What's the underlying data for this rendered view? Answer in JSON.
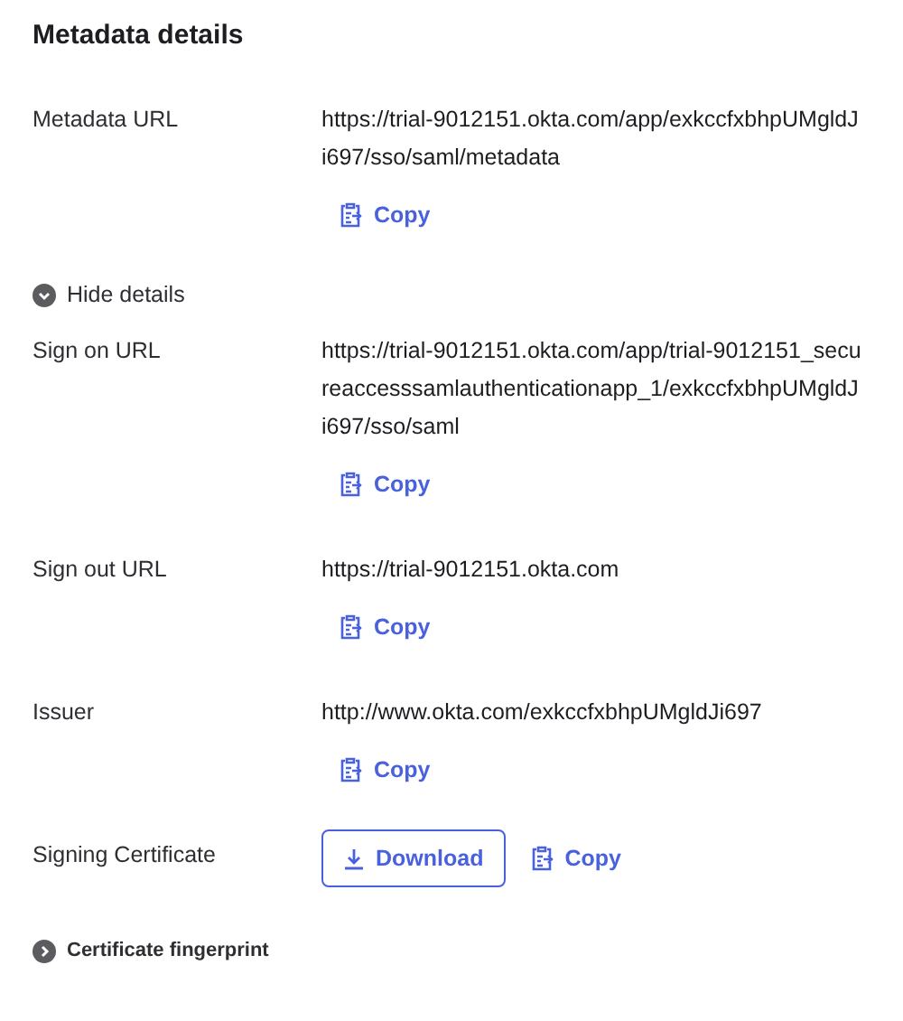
{
  "title": "Metadata details",
  "sections": [
    {
      "kind": "field",
      "label": "Metadata URL",
      "value": "https://trial-9012151.okta.com/app/exkccfxbhpUMgldJi697/sso/saml/metadata",
      "copy": "Copy"
    },
    {
      "kind": "toggle",
      "label": "Hide details",
      "expanded": true,
      "bold": false
    },
    {
      "kind": "field",
      "label": "Sign on URL",
      "value": "https://trial-9012151.okta.com/app/trial-9012151_secureaccesssamlauthenticationapp_1/exkccfxbhpUMgldJi697/sso/saml",
      "copy": "Copy"
    },
    {
      "kind": "field",
      "label": "Sign out URL",
      "value": "https://trial-9012151.okta.com",
      "copy": "Copy"
    },
    {
      "kind": "field",
      "label": "Issuer",
      "value": "http://www.okta.com/exkccfxbhpUMgldJi697",
      "copy": "Copy"
    },
    {
      "kind": "certificate",
      "label": "Signing Certificate",
      "download": "Download",
      "copy": "Copy"
    },
    {
      "kind": "toggle",
      "label": "Certificate fingerprint",
      "expanded": false,
      "bold": true
    }
  ]
}
